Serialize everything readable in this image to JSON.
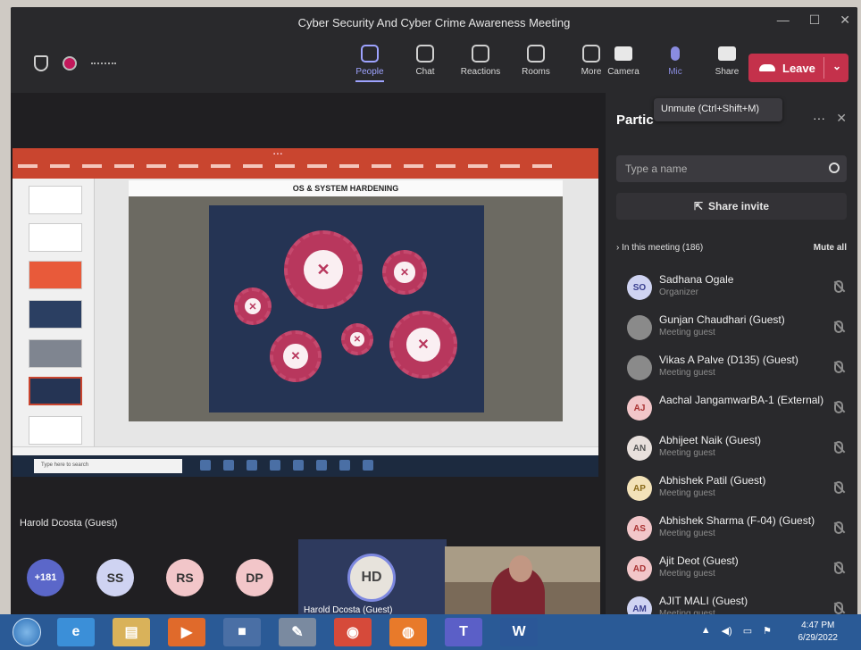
{
  "window": {
    "title": "Cyber Security And Cyber Crime Awareness Meeting"
  },
  "toolbar": {
    "items": [
      {
        "label": "People",
        "icon": "people-icon"
      },
      {
        "label": "Chat",
        "icon": "chat-icon"
      },
      {
        "label": "Reactions",
        "icon": "reactions-icon"
      },
      {
        "label": "Rooms",
        "icon": "rooms-icon"
      },
      {
        "label": "More",
        "icon": "more-icon"
      }
    ],
    "camera": "Camera",
    "mic": "Mic",
    "share": "Share",
    "leave": "Leave"
  },
  "shared": {
    "slide_title": "OS & SYSTEM HARDENING",
    "search_placeholder": "Type here to search"
  },
  "stage": {
    "presenter_name": "Harold Dcosta (Guest)",
    "avatars": [
      {
        "initials": "+181",
        "color": "#5b67c9"
      },
      {
        "initials": "SS",
        "color": "#cfd3f2"
      },
      {
        "initials": "RS",
        "color": "#f2c6c9"
      },
      {
        "initials": "DP",
        "color": "#f2c6c9"
      }
    ],
    "hd_initials": "HD",
    "hd_name": "Harold Dcosta (Guest)"
  },
  "panel": {
    "title": "Partic",
    "tooltip": "Unmute (Ctrl+Shift+M)",
    "search_placeholder": "Type a name",
    "share_invite": "Share invite",
    "section": "In this meeting (186)",
    "mute_all": "Mute all",
    "participants": [
      {
        "initials": "SO",
        "name": "Sadhana Ogale",
        "role": "Organizer",
        "bg": "#cfd3f2",
        "fg": "#3a3f8f"
      },
      {
        "initials": "",
        "name": "Gunjan Chaudhari (Guest)",
        "role": "Meeting guest",
        "bg": "#8a8a8a",
        "fg": "#fff"
      },
      {
        "initials": "",
        "name": "Vikas A Palve (D135) (Guest)",
        "role": "Meeting guest",
        "bg": "#8a8a8a",
        "fg": "#fff"
      },
      {
        "initials": "AJ",
        "name": "Aachal JangamwarBA-1 (External)",
        "role": "",
        "bg": "#f2c6c9",
        "fg": "#a33"
      },
      {
        "initials": "AN",
        "name": "Abhijeet Naik (Guest)",
        "role": "Meeting guest",
        "bg": "#e8e0dc",
        "fg": "#555"
      },
      {
        "initials": "AP",
        "name": "Abhishek Patil (Guest)",
        "role": "Meeting guest",
        "bg": "#f3e2b8",
        "fg": "#8a6a1a"
      },
      {
        "initials": "AS",
        "name": "Abhishek Sharma (F-04) (Guest)",
        "role": "Meeting guest",
        "bg": "#f2c6c9",
        "fg": "#a33"
      },
      {
        "initials": "AD",
        "name": "Ajit Deot (Guest)",
        "role": "Meeting guest",
        "bg": "#f2c6c9",
        "fg": "#a33"
      },
      {
        "initials": "AM",
        "name": "AJIT MALI (Guest)",
        "role": "Meeting guest",
        "bg": "#cfd3f2",
        "fg": "#3a3f8f"
      }
    ]
  },
  "taskbar": {
    "time": "4:47 PM",
    "date": "6/29/2022",
    "apps": [
      {
        "glyph": "e",
        "color": "#3b8fd8"
      },
      {
        "glyph": "▤",
        "color": "#d9b25a"
      },
      {
        "glyph": "▶",
        "color": "#e06a2b"
      },
      {
        "glyph": "■",
        "color": "#4a6fa5"
      },
      {
        "glyph": "✎",
        "color": "#7a8aa0"
      },
      {
        "glyph": "◉",
        "color": "#d64a3a"
      },
      {
        "glyph": "◍",
        "color": "#e87a2a"
      },
      {
        "glyph": "T",
        "color": "#5b5fc7"
      },
      {
        "glyph": "W",
        "color": "#2b5797"
      }
    ]
  }
}
